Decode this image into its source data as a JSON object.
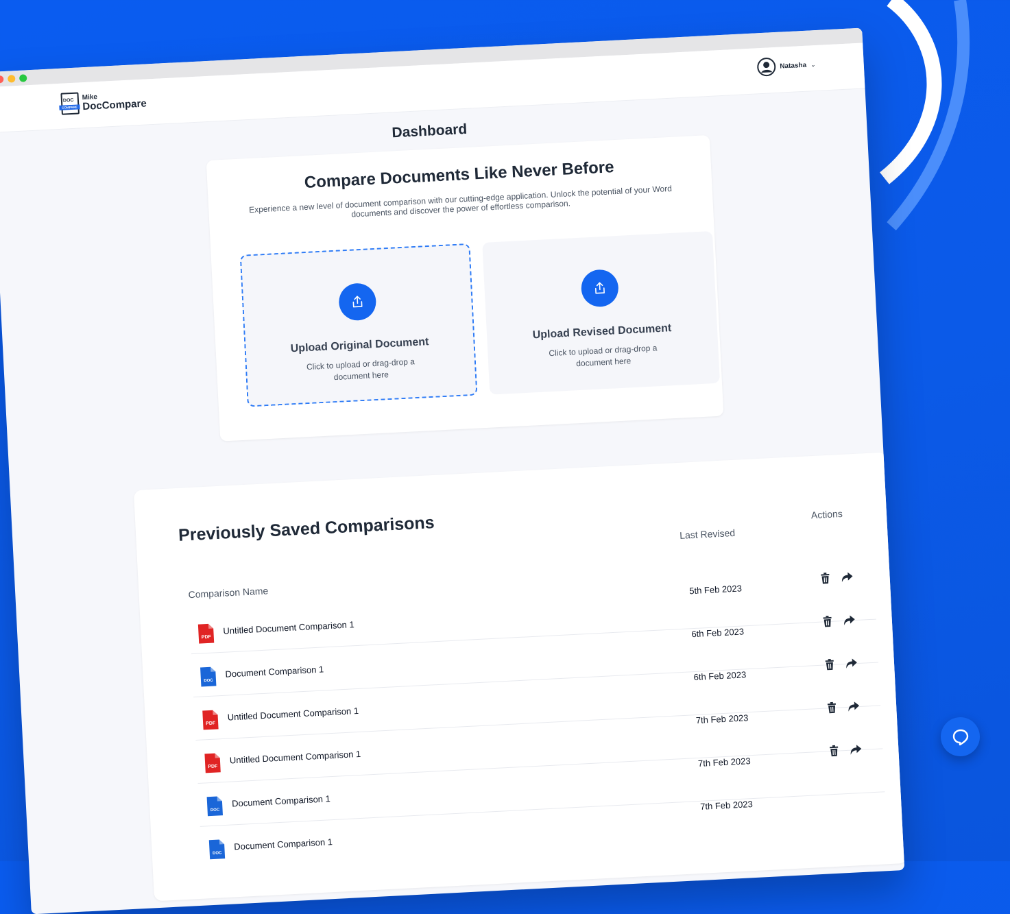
{
  "app": {
    "logo_small": "Mike",
    "logo_name": "DocCompare",
    "logo_badge": "DOC",
    "logo_band": "COMPARE"
  },
  "user": {
    "name": "Natasha",
    "menu_icon": "chevron-down-icon"
  },
  "page": {
    "title": "Dashboard"
  },
  "hero": {
    "heading": "Compare Documents Like Never Before",
    "description": "Experience a new level of document comparison with our cutting-edge application. Unlock the potential of your Word documents and discover the power of effortless comparison.",
    "upload_original": {
      "title": "Upload Original Document",
      "subtitle": "Click to upload or drag-drop a document here",
      "icon": "upload-icon"
    },
    "upload_revised": {
      "title": "Upload Revised Document",
      "subtitle": "Click to upload or drag-drop a document here",
      "icon": "upload-icon"
    }
  },
  "saved": {
    "heading": "Previously Saved Comparisons",
    "columns": {
      "name": "Comparison Name",
      "last_revised": "Last Revised",
      "actions": "Actions"
    },
    "rows": [
      {
        "type": "PDF",
        "name": "Untitled Document Comparison 1",
        "date": "5th Feb 2023"
      },
      {
        "type": "DOC",
        "name": "Document Comparison 1",
        "date": "6th Feb 2023"
      },
      {
        "type": "PDF",
        "name": "Untitled Document Comparison 1",
        "date": "6th Feb 2023"
      },
      {
        "type": "PDF",
        "name": "Untitled Document Comparison 1",
        "date": "7th Feb 2023"
      },
      {
        "type": "DOC",
        "name": "Document Comparison 1",
        "date": "7th Feb 2023"
      },
      {
        "type": "DOC",
        "name": "Document Comparison 1",
        "date": "7th Feb 2023"
      }
    ],
    "action_icons": [
      "trash-icon",
      "share-icon"
    ]
  },
  "colors": {
    "background": "#0a5cf0",
    "accent": "#1466f0",
    "pdf": "#e02424",
    "doc": "#1a66d8"
  },
  "chat": {
    "icon": "chat-bubble-icon"
  }
}
